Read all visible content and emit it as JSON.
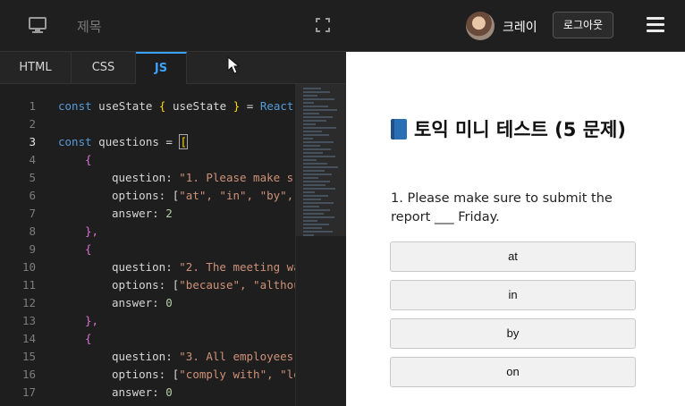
{
  "header": {
    "title": "제목",
    "user_name": "크레이",
    "logout_label": "로그아웃"
  },
  "editor": {
    "tabs": [
      {
        "label": "HTML"
      },
      {
        "label": "CSS"
      },
      {
        "label": "JS"
      }
    ],
    "line_numbers": [
      "1",
      "2",
      "3",
      "4",
      "5",
      "6",
      "7",
      "8",
      "9",
      "10",
      "11",
      "12",
      "13",
      "14",
      "15",
      "16",
      "17"
    ],
    "code": {
      "line1": {
        "kw": "const",
        "b1": "{",
        "v": " useState ",
        "b2": "}",
        "eq": " = ",
        "r": "React"
      },
      "line3": {
        "kw": "const",
        "v": " questions = ",
        "b": "["
      },
      "line4": "{",
      "line5": {
        "k": "question: ",
        "s": "\"1. Please make s"
      },
      "line6": {
        "k": "options: [",
        "s": "\"at\", \"in\", \"by\","
      },
      "line7": {
        "k": "answer: ",
        "n": "2"
      },
      "line8": "},",
      "line9": "{",
      "line10": {
        "k": "question: ",
        "s": "\"2. The meeting wa"
      },
      "line11": {
        "k": "options: [",
        "s": "\"because\", \"althou"
      },
      "line12": {
        "k": "answer: ",
        "n": "0"
      },
      "line13": "},",
      "line14": "{",
      "line15": {
        "k": "question: ",
        "s": "\"3. All employees"
      },
      "line16": {
        "k": "options: [",
        "s": "\"comply with\", \"le"
      },
      "line17": {
        "k": "answer: ",
        "n": "0"
      }
    }
  },
  "preview": {
    "title": "토익 미니 테스트 (5 문제)",
    "question": "1. Please make sure to submit the report ___ Friday.",
    "options": [
      "at",
      "in",
      "by",
      "on"
    ]
  }
}
